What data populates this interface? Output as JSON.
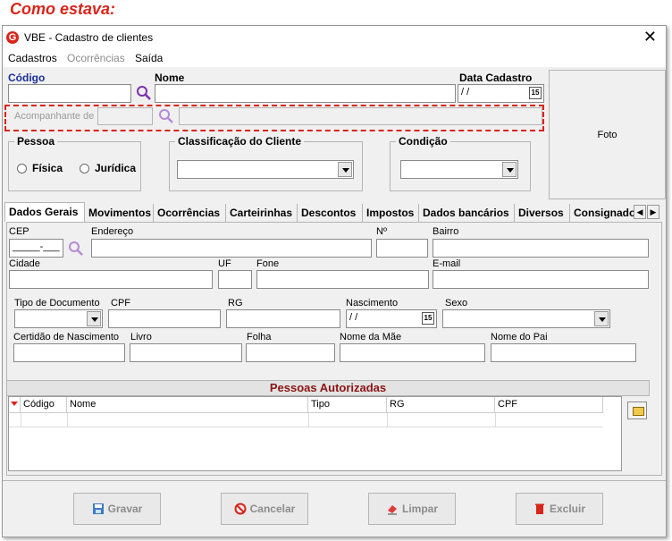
{
  "caption": "Como estava:",
  "window": {
    "title": "VBE - Cadastro de clientes",
    "close": "✕"
  },
  "menu": [
    {
      "label": "Cadastros",
      "enabled": true
    },
    {
      "label": "Ocorrências",
      "enabled": false
    },
    {
      "label": "Saída",
      "enabled": true
    }
  ],
  "header": {
    "codigo_label": "Código",
    "nome_label": "Nome",
    "data_cadastro_label": "Data Cadastro",
    "data_cadastro_value": " / /",
    "acompanhante_label": "Acompanhante de",
    "foto_label": "Foto"
  },
  "pessoa": {
    "title": "Pessoa",
    "fisica": "Física",
    "juridica": "Jurídica"
  },
  "classificacao": {
    "title": "Classificação do Cliente"
  },
  "condicao": {
    "title": "Condição"
  },
  "tabs": [
    "Dados Gerais",
    "Movimentos",
    "Ocorrências",
    "Carteirinhas",
    "Descontos",
    "Impostos",
    "Dados bancários",
    "Diversos",
    "Consignado"
  ],
  "form": {
    "cep": "CEP",
    "cep_value": "_____-___",
    "endereco": "Endereço",
    "numero": "Nº",
    "bairro": "Bairro",
    "cidade": "Cidade",
    "uf": "UF",
    "fone": "Fone",
    "email": "E-mail",
    "tipo_documento": "Tipo de Documento",
    "cpf": "CPF",
    "rg": "RG",
    "nascimento": "Nascimento",
    "nascimento_value": " / /",
    "sexo": "Sexo",
    "certidao": "Certidão de Nascimento",
    "livro": "Livro",
    "folha": "Folha",
    "nome_mae": "Nome da Mãe",
    "nome_pai": "Nome do Pai"
  },
  "autorizadas": {
    "title": "Pessoas Autorizadas",
    "columns": [
      "Código",
      "Nome",
      "Tipo",
      "RG",
      "CPF"
    ]
  },
  "buttons": {
    "gravar": "Gravar",
    "cancelar": "Cancelar",
    "limpar": "Limpar",
    "excluir": "Excluir"
  },
  "colors": {
    "accent_red": "#d9251b",
    "label_blue": "#1c2f9a",
    "grid_title": "#8b1414"
  }
}
